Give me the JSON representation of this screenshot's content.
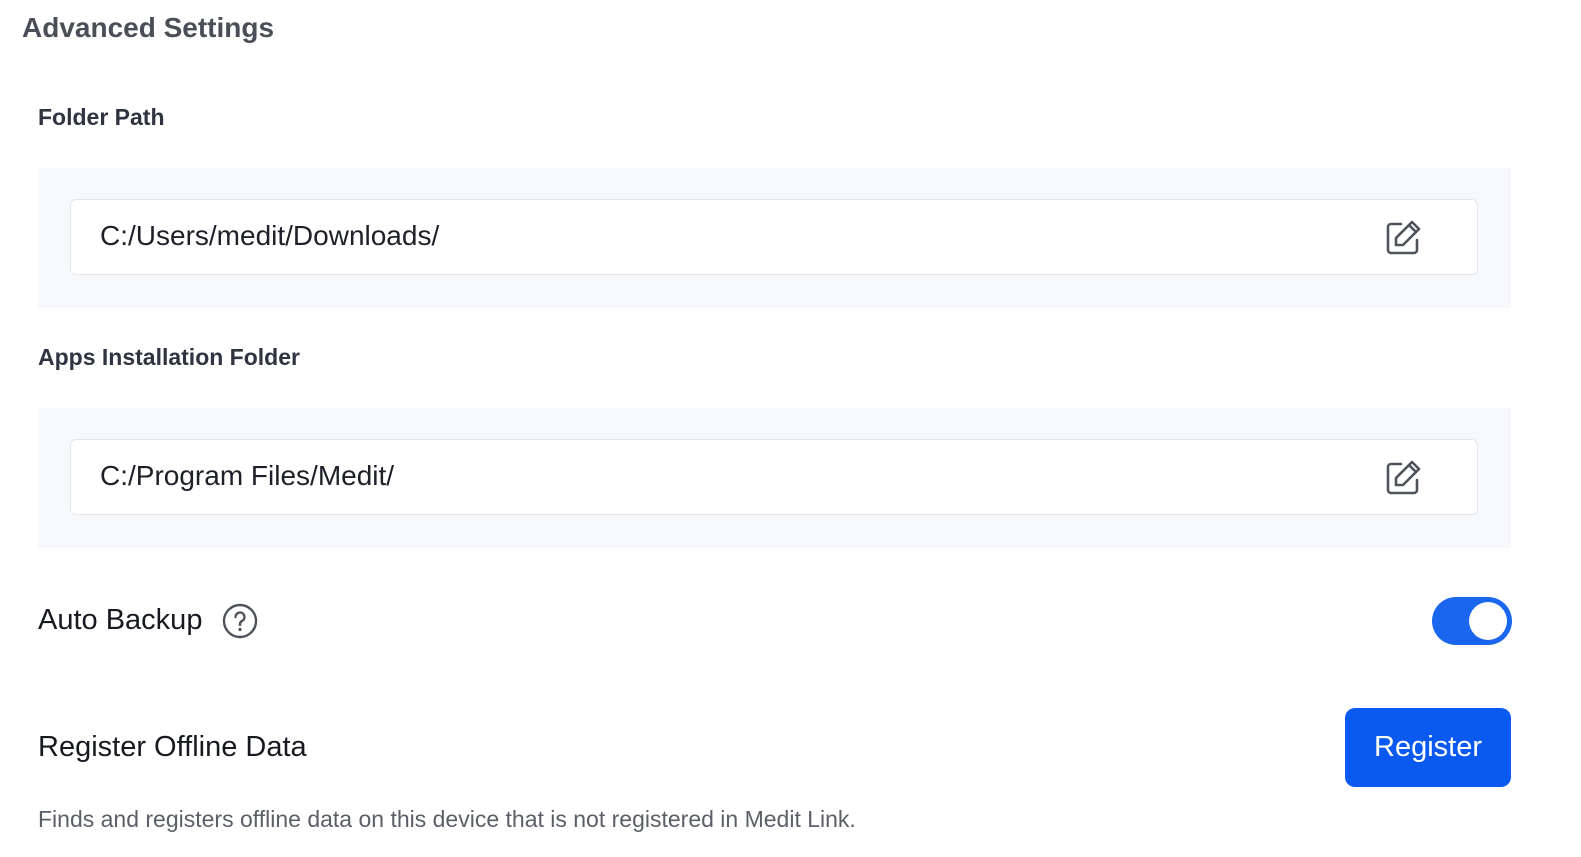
{
  "page": {
    "title": "Advanced Settings"
  },
  "folder_path": {
    "label": "Folder Path",
    "value": "C:/Users/medit/Downloads/",
    "edit_icon": "edit-icon"
  },
  "apps_installation_folder": {
    "label": "Apps Installation Folder",
    "value": "C:/Program Files/Medit/",
    "edit_icon": "edit-icon"
  },
  "auto_backup": {
    "label": "Auto Backup",
    "help_icon": "question-circle-icon",
    "enabled": true
  },
  "register_offline_data": {
    "label": "Register Offline Data",
    "button_label": "Register",
    "description": "Finds and registers offline data on this device that is not registered in Medit Link."
  },
  "colors": {
    "accent": "#0a5af2",
    "toggle_on": "#1a66ee",
    "panel_bg": "#f7f8fb"
  }
}
